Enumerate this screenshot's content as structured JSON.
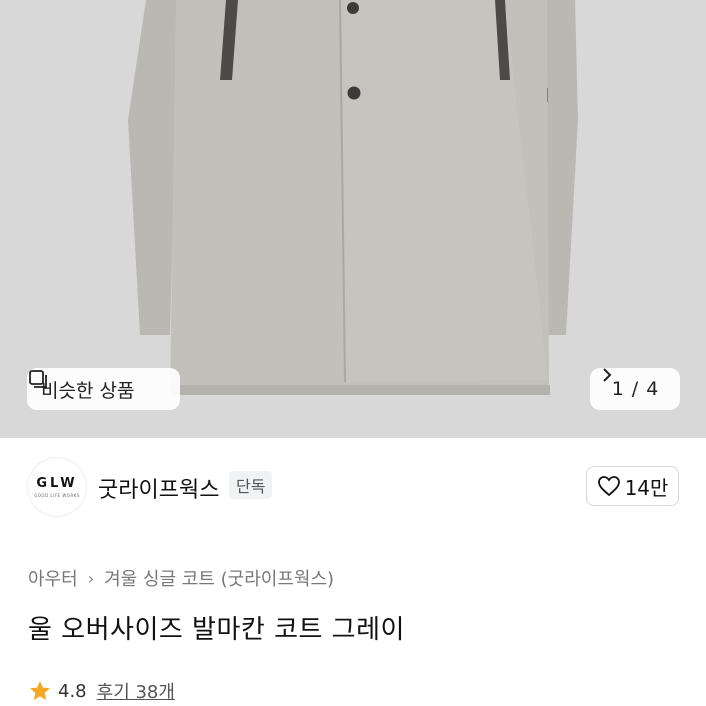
{
  "hero": {
    "similar_label": "비슷한 상품",
    "pager": {
      "current": "1",
      "separator": "/",
      "total": "4"
    },
    "background": "#d9d9d9"
  },
  "brand": {
    "logo_text": "GLW",
    "logo_subtext": "GOOD LIFE WORKS",
    "name": "굿라이프웍스",
    "tag": "단독",
    "likes": "14만"
  },
  "breadcrumb": {
    "category": "아우터",
    "subcategory": "겨울 싱글 코트 (굿라이프웍스)"
  },
  "product": {
    "title": "울 오버사이즈 발마칸 코트 그레이"
  },
  "rating": {
    "score": "4.8",
    "reviews_label": "후기 38개",
    "star_color": "#f5a623"
  }
}
